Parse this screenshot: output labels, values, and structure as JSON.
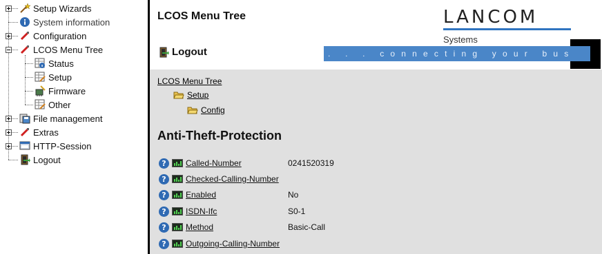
{
  "sidebar": {
    "items": [
      {
        "label": "Setup Wizards",
        "icon": "wand-icon"
      },
      {
        "label": "System information",
        "icon": "info-icon"
      },
      {
        "label": "Configuration",
        "icon": "config-icon"
      },
      {
        "label": "LCOS Menu Tree",
        "icon": "config-icon"
      },
      {
        "label": "Status",
        "icon": "table-info-icon"
      },
      {
        "label": "Setup",
        "icon": "table-edit-icon"
      },
      {
        "label": "Firmware",
        "icon": "firmware-icon"
      },
      {
        "label": "Other",
        "icon": "table-edit-icon"
      },
      {
        "label": "File management",
        "icon": "file-management-icon"
      },
      {
        "label": "Extras",
        "icon": "extras-icon"
      },
      {
        "label": "HTTP-Session",
        "icon": "http-session-icon"
      },
      {
        "label": "Logout",
        "icon": "logout-icon"
      }
    ]
  },
  "header": {
    "title": "LCOS Menu Tree",
    "logo_text": "LANCOM",
    "logo_sub": "Systems",
    "logout_label": "Logout",
    "banner_text": ". . .  connecting  your  business"
  },
  "breadcrumb": {
    "items": [
      "LCOS Menu Tree",
      "Setup",
      "Config"
    ]
  },
  "section": {
    "title": "Anti-Theft-Protection"
  },
  "params": [
    {
      "name": "Called-Number",
      "value": "0241520319"
    },
    {
      "name": "Checked-Calling-Number",
      "value": ""
    },
    {
      "name": "Enabled",
      "value": "No"
    },
    {
      "name": "ISDN-Ifc",
      "value": "S0-1"
    },
    {
      "name": "Method",
      "value": "Basic-Call"
    },
    {
      "name": "Outgoing-Calling-Number",
      "value": ""
    }
  ],
  "colors": {
    "banner": "#4a86c8",
    "logo_line": "#2f74c0",
    "content_bg": "#e0e0e0",
    "help_icon": "#2f6ab3"
  }
}
